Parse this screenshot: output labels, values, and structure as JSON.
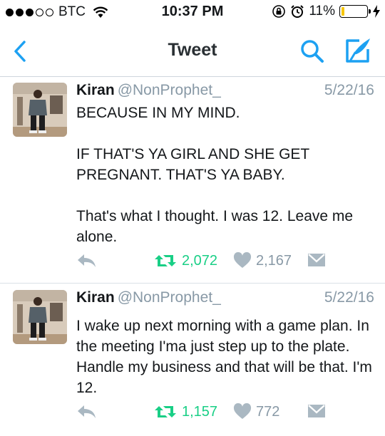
{
  "status_bar": {
    "carrier": "BTC",
    "time": "10:37 PM",
    "battery": "11%",
    "battery_level": 0.11
  },
  "nav": {
    "title": "Tweet"
  },
  "tweets": [
    {
      "name": "Kiran",
      "handle": "@NonProphet_",
      "date": "5/22/16",
      "paragraphs": [
        "BECAUSE IN MY MIND.",
        "IF THAT'S YA GIRL AND SHE GET PREGNANT. THAT'S YA BABY.",
        "That's what I thought. I was 12. Leave me alone."
      ],
      "retweets": "2,072",
      "likes": "2,167"
    },
    {
      "name": "Kiran",
      "handle": "@NonProphet_",
      "date": "5/22/16",
      "paragraphs": [
        "I wake up next morning with a game plan. In the meeting I'ma just step up to the plate. Handle my business and that will be that. I'm 12."
      ],
      "retweets": "1,157",
      "likes": "772"
    }
  ],
  "icons": {
    "back": "chevron-left-icon",
    "search": "search-icon",
    "compose": "compose-icon",
    "reply": "reply-icon",
    "retweet": "retweet-icon",
    "like": "heart-icon",
    "dm": "envelope-icon"
  },
  "colors": {
    "accent": "#1da1f2",
    "retweet": "#19cf86",
    "muted": "#8899a6"
  }
}
